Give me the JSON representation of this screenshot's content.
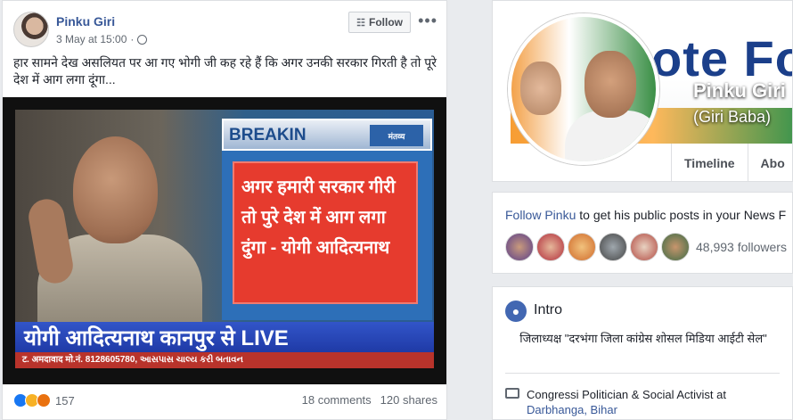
{
  "post": {
    "author": "Pinku Giri",
    "timestamp": "3 May at 15:00",
    "separator": "·",
    "follow_label": "Follow",
    "more_label": "•••",
    "text": "हार सामने देख असलियत पर आ गए भोगी जी कह रहे हैं कि अगर उनकी सरकार गिरती है तो पूरे देश में आग लगा दूंगा...",
    "image": {
      "breaking_label": "BREAKIN",
      "channel_logo": "मंतव्य",
      "headline": "अगर हमारी सरकार गीरी तो पुरे देश में आग लगा दुंगा - योगी आदित्यनाथ",
      "ticker": "योगी आदित्यनाथ कानपुर से LIVE",
      "strip": "ट. अमदावाद मो.नं. 8128605780, આસપાસ ચાલ્ય કરી બતાવન"
    },
    "reactions_count": "157",
    "comments": "18 comments",
    "shares": "120 shares"
  },
  "profile": {
    "cover_text": "ote Fo",
    "name": "Pinku Giri",
    "alt_name": "(Giri Baba)",
    "tabs": [
      "Timeline",
      "Abo"
    ]
  },
  "follow_card": {
    "link": "Follow Pinku",
    "rest": " to get his public posts in your News F",
    "followers": "48,993 followers"
  },
  "intro": {
    "title": "Intro",
    "bio": "जिलाध्यक्ष \"दरभंगा जिला कांग्रेस शोसल मिडिया आईटी सेल\"",
    "work_prefix": "Congressi Politician & Social Activist at",
    "work_place": "Darbhanga, Bihar"
  },
  "colors": {
    "link": "#385898",
    "background": "#e9ebee",
    "like": "#1877f2",
    "headline_red": "#e63b2e",
    "ticker_blue": "#2a48b8"
  }
}
